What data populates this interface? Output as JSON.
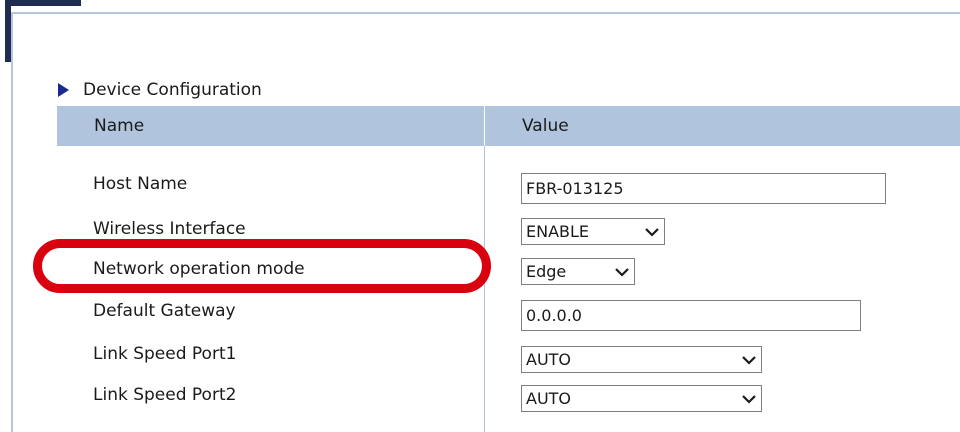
{
  "section": {
    "title": "Device Configuration"
  },
  "table": {
    "headers": {
      "name": "Name",
      "value": "Value"
    },
    "rows": [
      {
        "label": "Host Name",
        "value": "FBR-013125"
      },
      {
        "label": "Wireless Interface",
        "value": "ENABLE"
      },
      {
        "label": "Network operation mode",
        "value": "Edge"
      },
      {
        "label": "Default Gateway",
        "value": "0.0.0.0"
      },
      {
        "label": "Link Speed Port1",
        "value": "AUTO"
      },
      {
        "label": "Link Speed Port2",
        "value": "AUTO"
      }
    ]
  },
  "colors": {
    "header_bg": "#b1c4de",
    "frame_accent": "#1f2d50",
    "highlight": "#d9000f",
    "bullet": "#1a2a8c"
  },
  "icons": {
    "section_bullet": "triangle-right-icon",
    "select_arrow": "chevron-down-icon"
  }
}
